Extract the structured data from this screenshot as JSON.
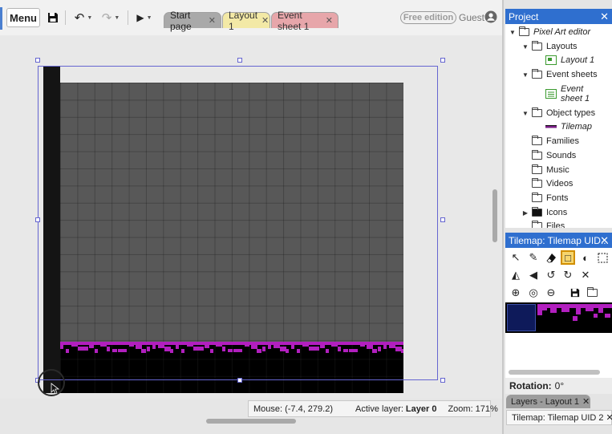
{
  "toolbar": {
    "menu_label": "Menu",
    "save_icon": "save-icon",
    "undo_icon": "undo-icon",
    "redo_icon": "redo-icon",
    "play_icon": "play-icon",
    "free_edition_label": "Free edition",
    "guest_label": "Guest"
  },
  "tabs": [
    {
      "label": "Start page",
      "color": "#a9a9a9"
    },
    {
      "label": "Layout 1",
      "color": "#f3e9a6",
      "active": true
    },
    {
      "label": "Event sheet 1",
      "color": "#e7a6aa"
    }
  ],
  "status": {
    "mouse_label": "Mouse:",
    "mouse_value": "(-7.4, 279.2)",
    "active_layer_label": "Active layer:",
    "active_layer_value": "Layer 0",
    "zoom_label": "Zoom:",
    "zoom_value": "171%"
  },
  "project_panel": {
    "title": "Project",
    "tree": [
      {
        "label": "Pixel Art editor",
        "italic": true
      },
      {
        "label": "Layouts"
      },
      {
        "label": "Layout 1",
        "italic": true
      },
      {
        "label": "Event sheets"
      },
      {
        "label": "Event",
        "label2": "sheet 1",
        "italic": true
      },
      {
        "label": "Object types"
      },
      {
        "label": "Tilemap",
        "italic": true
      },
      {
        "label": "Families"
      },
      {
        "label": "Sounds"
      },
      {
        "label": "Music"
      },
      {
        "label": "Videos"
      },
      {
        "label": "Fonts"
      },
      {
        "label": "Icons"
      },
      {
        "label": "Files"
      }
    ]
  },
  "tilemap_panel": {
    "title": "Tilemap: Tilemap UID...",
    "tools": [
      "select-icon",
      "pencil-icon",
      "eraser-icon",
      "rectangle-icon",
      "fill-bucket-icon",
      "marquee-icon",
      "mirror-icon",
      "flip-icon",
      "rotate-ccw-icon",
      "rotate-cw-icon",
      "close-icon",
      "zoom-in-icon",
      "zoom-reset-icon",
      "zoom-out-icon",
      "save-icon",
      "open-folder-icon"
    ]
  },
  "properties": {
    "rotation_label": "Rotation:",
    "rotation_value": "0°"
  },
  "bottom_tabs": {
    "layers": "Layers - Layout 1",
    "tilemap": "Tilemap: Tilemap UID 2"
  },
  "colors": {
    "accent": "#2f6fcf",
    "tile_grass": "#b21fbf",
    "layout_bg": "#585858",
    "selection": "#6565d0"
  }
}
